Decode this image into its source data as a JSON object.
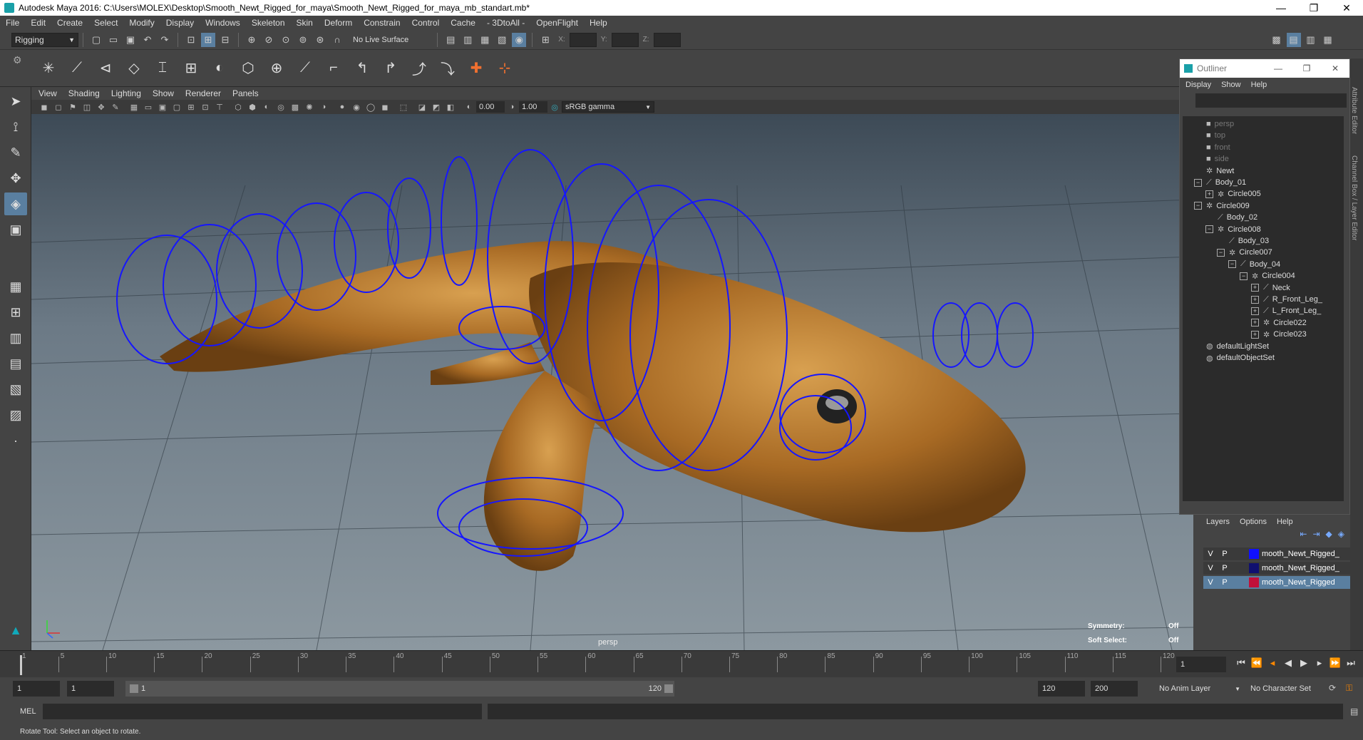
{
  "window": {
    "title": "Autodesk Maya 2016: C:\\Users\\MOLEX\\Desktop\\Smooth_Newt_Rigged_for_maya\\Smooth_Newt_Rigged_for_maya_mb_standart.mb*",
    "minimize": "—",
    "restore": "❐",
    "close": "✕"
  },
  "menu": [
    "File",
    "Edit",
    "Create",
    "Select",
    "Modify",
    "Display",
    "Windows",
    "Skeleton",
    "Skin",
    "Deform",
    "Constrain",
    "Control",
    "Cache",
    "- 3DtoAll -",
    "OpenFlight",
    "Help"
  ],
  "statusline": {
    "menu_set": "Rigging",
    "live_surface": "No Live Surface",
    "x_label": "X:",
    "y_label": "Y:",
    "z_label": "Z:"
  },
  "panel_menu": [
    "View",
    "Shading",
    "Lighting",
    "Show",
    "Renderer",
    "Panels"
  ],
  "panel_toolbar": {
    "exposure": "0.00",
    "gamma": "1.00",
    "color_space": "sRGB gamma"
  },
  "viewport": {
    "camera": "persp",
    "symmetry_label": "Symmetry:",
    "symmetry_value": "Off",
    "soft_select_label": "Soft Select:",
    "soft_select_value": "Off"
  },
  "outliner": {
    "title": "Outliner",
    "menu": [
      "Display",
      "Show",
      "Help"
    ],
    "items": [
      {
        "label": "persp",
        "icon": "camera-icon",
        "depth": 0,
        "exp": "",
        "dim": true
      },
      {
        "label": "top",
        "icon": "camera-icon",
        "depth": 0,
        "exp": "",
        "dim": true
      },
      {
        "label": "front",
        "icon": "camera-icon",
        "depth": 0,
        "exp": "",
        "dim": true
      },
      {
        "label": "side",
        "icon": "camera-icon",
        "depth": 0,
        "exp": "",
        "dim": true
      },
      {
        "label": "Newt",
        "icon": "transform-icon",
        "depth": 0,
        "exp": "",
        "dim": false
      },
      {
        "label": "Body_01",
        "icon": "joint-icon",
        "depth": 0,
        "exp": "−",
        "dim": false
      },
      {
        "label": "Circle005",
        "icon": "transform-icon",
        "depth": 1,
        "exp": "+",
        "dim": false
      },
      {
        "label": "Circle009",
        "icon": "transform-icon",
        "depth": 0,
        "exp": "−",
        "dim": false
      },
      {
        "label": "Body_02",
        "icon": "joint-icon",
        "depth": 1,
        "exp": "",
        "dim": false
      },
      {
        "label": "Circle008",
        "icon": "transform-icon",
        "depth": 1,
        "exp": "−",
        "dim": false
      },
      {
        "label": "Body_03",
        "icon": "joint-icon",
        "depth": 2,
        "exp": "",
        "dim": false
      },
      {
        "label": "Circle007",
        "icon": "transform-icon",
        "depth": 2,
        "exp": "−",
        "dim": false
      },
      {
        "label": "Body_04",
        "icon": "joint-icon",
        "depth": 3,
        "exp": "−",
        "dim": false
      },
      {
        "label": "Circle004",
        "icon": "transform-icon",
        "depth": 4,
        "exp": "−",
        "dim": false
      },
      {
        "label": "Neck",
        "icon": "joint-icon",
        "depth": 5,
        "exp": "+",
        "dim": false
      },
      {
        "label": "R_Front_Leg_",
        "icon": "joint-icon",
        "depth": 5,
        "exp": "+",
        "dim": false
      },
      {
        "label": "L_Front_Leg_",
        "icon": "joint-icon",
        "depth": 5,
        "exp": "+",
        "dim": false
      },
      {
        "label": "Circle022",
        "icon": "transform-icon",
        "depth": 5,
        "exp": "+",
        "dim": false
      },
      {
        "label": "Circle023",
        "icon": "transform-icon",
        "depth": 5,
        "exp": "+",
        "dim": false
      },
      {
        "label": "defaultLightSet",
        "icon": "set-icon",
        "depth": 0,
        "exp": "",
        "dim": false
      },
      {
        "label": "defaultObjectSet",
        "icon": "set-icon",
        "depth": 0,
        "exp": "",
        "dim": false
      }
    ]
  },
  "layers": {
    "menu": [
      "Layers",
      "Options",
      "Help"
    ],
    "rows": [
      {
        "v": "V",
        "p": "P",
        "name": "mooth_Newt_Rigged_",
        "color": "#1010ff",
        "selected": false
      },
      {
        "v": "V",
        "p": "P",
        "name": "mooth_Newt_Rigged_",
        "color": "#101070",
        "selected": false
      },
      {
        "v": "V",
        "p": "P",
        "name": "mooth_Newt_Rigged",
        "color": "#c0103a",
        "selected": true
      }
    ]
  },
  "side_tabs": [
    "Attribute Editor",
    "Channel Box / Layer Editor"
  ],
  "timeline": {
    "ticks": [
      "1",
      "5",
      "10",
      "15",
      "20",
      "25",
      "30",
      "35",
      "40",
      "45",
      "50",
      "55",
      "60",
      "65",
      "70",
      "75",
      "80",
      "85",
      "90",
      "95",
      "100",
      "105",
      "110",
      "115",
      "120"
    ],
    "current_frame": "1"
  },
  "range": {
    "start": "1",
    "start2": "1",
    "slider_start": "1",
    "slider_end": "120",
    "end": "120",
    "max_end": "200",
    "anim_layer": "No Anim Layer",
    "char_set": "No Character Set"
  },
  "cmd": {
    "label": "MEL"
  },
  "help": {
    "text": "Rotate Tool: Select an object to rotate."
  }
}
